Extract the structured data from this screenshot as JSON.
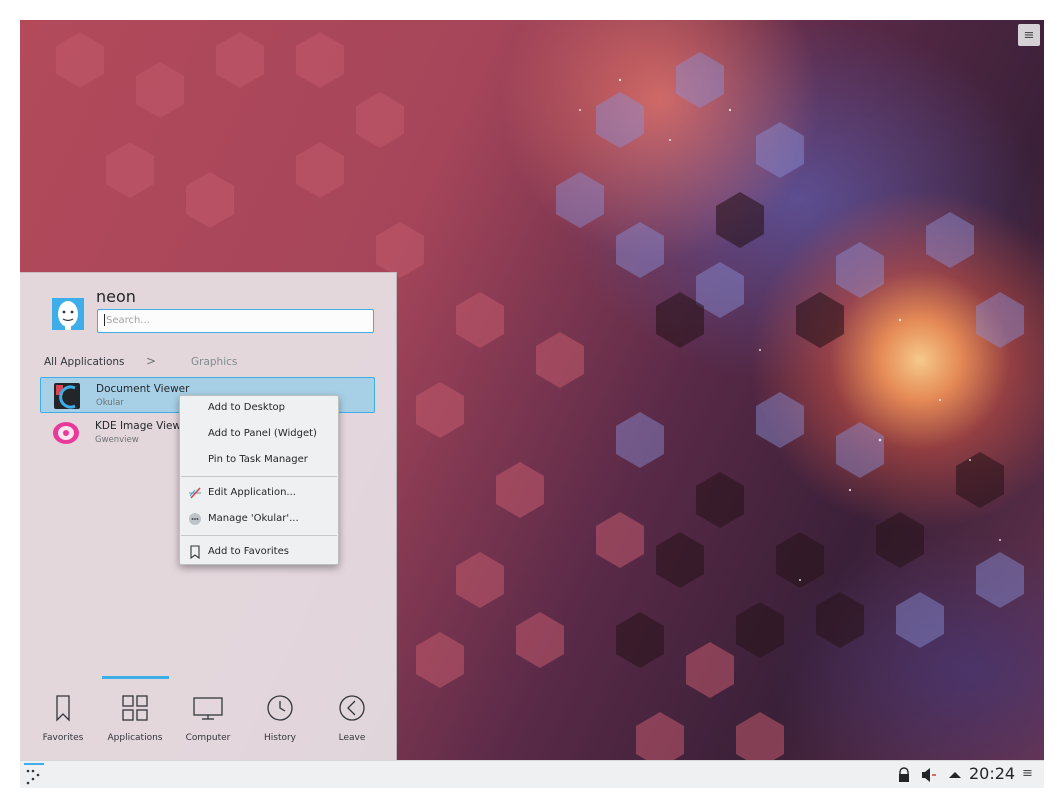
{
  "desktop": {
    "menu_glyph": "≡"
  },
  "launcher": {
    "user_name": "neon",
    "search_placeholder": "Search...",
    "breadcrumb": {
      "root": "All Applications",
      "separator": ">",
      "current": "Graphics"
    },
    "apps": [
      {
        "name": "Document Viewer",
        "generic": "Okular",
        "icon": "okular-icon",
        "selected": true
      },
      {
        "name": "KDE Image Viewer",
        "generic": "Gwenview",
        "icon": "gwenview-icon",
        "selected": false
      }
    ],
    "tabs": [
      {
        "label": "Favorites",
        "icon": "bookmark-icon"
      },
      {
        "label": "Applications",
        "icon": "applications-grid-icon",
        "active": true
      },
      {
        "label": "Computer",
        "icon": "computer-icon"
      },
      {
        "label": "History",
        "icon": "history-clock-icon"
      },
      {
        "label": "Leave",
        "icon": "leave-icon"
      }
    ]
  },
  "context_menu": {
    "items": [
      {
        "label": "Add to Desktop",
        "icon": ""
      },
      {
        "label": "Add to Panel (Widget)",
        "icon": ""
      },
      {
        "label": "Pin to Task Manager",
        "icon": ""
      },
      {
        "label": "Edit Application...",
        "icon": "edit-icon"
      },
      {
        "label": "Manage 'Okular'...",
        "icon": "more-icon"
      },
      {
        "label": "Add to Favorites",
        "icon": "bookmark-icon"
      }
    ]
  },
  "panel": {
    "clock": "20:24",
    "menu_glyph": "≡",
    "tray": [
      "lock-icon",
      "volume-muted-icon",
      "expand-arrow-icon"
    ]
  },
  "colors": {
    "accent": "#3daee9",
    "selection": "#93cee9",
    "panel_bg": "#eff0f1"
  }
}
